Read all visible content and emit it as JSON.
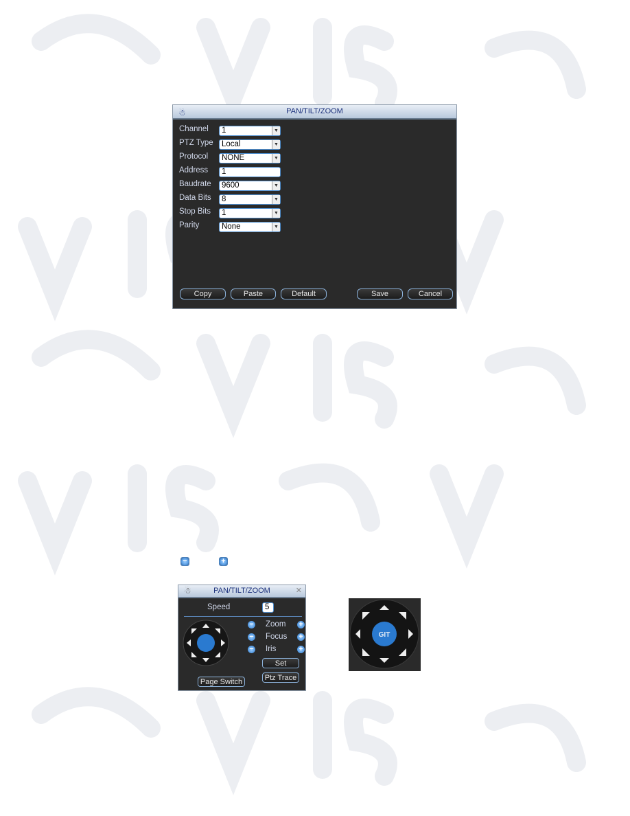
{
  "watermark": "QVIS",
  "ptz_dialog": {
    "title": "PAN/TILT/ZOOM",
    "fields": [
      {
        "label": "Channel",
        "value": "1",
        "type": "select"
      },
      {
        "label": "PTZ Type",
        "value": "Local",
        "type": "select"
      },
      {
        "label": "Protocol",
        "value": "NONE",
        "type": "select"
      },
      {
        "label": "Address",
        "value": "1",
        "type": "input"
      },
      {
        "label": "Baudrate",
        "value": "9600",
        "type": "select"
      },
      {
        "label": "Data Bits",
        "value": "8",
        "type": "select"
      },
      {
        "label": "Stop Bits",
        "value": "1",
        "type": "select"
      },
      {
        "label": "Parity",
        "value": "None",
        "type": "select"
      }
    ],
    "buttons": {
      "copy": "Copy",
      "paste": "Paste",
      "default": "Default",
      "save": "Save",
      "cancel": "Cancel"
    }
  },
  "inline_icons": {
    "minus": "minus-icon",
    "plus": "plus-icon"
  },
  "control_dialog": {
    "title": "PAN/TILT/ZOOM",
    "speed_label": "Speed",
    "speed_value": "5",
    "controls": [
      "Zoom",
      "Focus",
      "Iris"
    ],
    "set": "Set",
    "ptz_trace": "Ptz Trace",
    "page_switch": "Page Switch"
  },
  "joystick": {
    "center_label": "GIT"
  },
  "colors": {
    "dialog_bg": "#2a2a2a",
    "accent": "#2a7ad0",
    "title_text": "#1a2f7a"
  }
}
